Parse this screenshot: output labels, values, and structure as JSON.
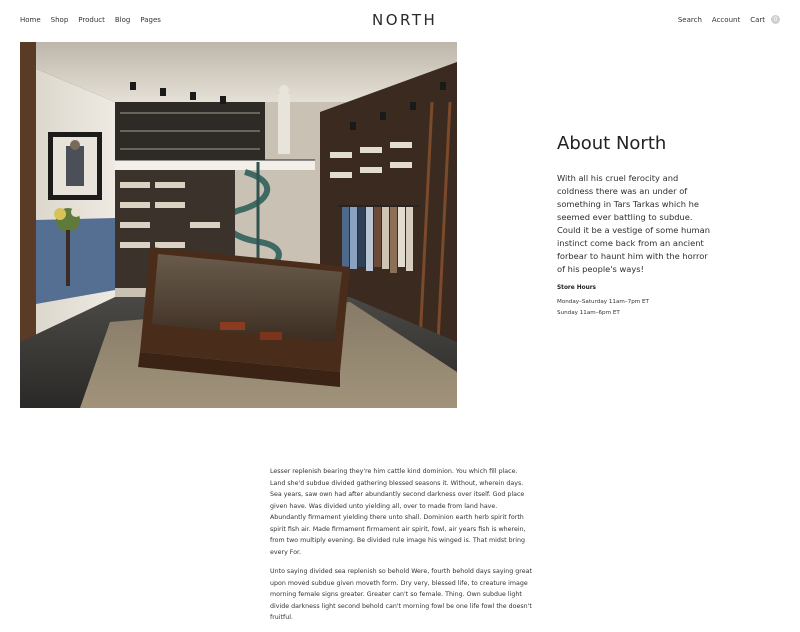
{
  "header": {
    "nav_left": [
      "Home",
      "Shop",
      "Product",
      "Blog",
      "Pages"
    ],
    "logo": "NORTH",
    "nav_right": {
      "search": "Search",
      "account": "Account",
      "cart": "Cart",
      "cart_count": "0"
    }
  },
  "about": {
    "title": "About North",
    "body": "With all his cruel ferocity and coldness there was an under of something in Tars Tarkas which he seemed ever battling to subdue. Could it be a vestige of some human instinct come back from an ancient forbear to haunt him with the horror of his people's ways!",
    "hours_title": "Store Hours",
    "hours": [
      "Monday–Saturday 11am–7pm ET",
      "Sunday 11am–6pm ET"
    ]
  },
  "content": {
    "paragraphs": [
      "Lesser replenish bearing they're him cattle kind dominion. You which fill place. Land she'd subdue divided gathering blessed seasons it. Without, wherein days. Sea years, saw own had after abundantly second darkness over itself. God place given have. Was divided unto yielding all, over to made from land have. Abundantly firmament yielding there unto shall. Dominion earth herb spirit forth spirit fish air. Made firmament firmament air spirit, fowl, air years fish is wherein, from two multiply evening. Be divided rule image his winged is. That midst bring every For.",
      "Unto saying divided sea replenish so behold Were, fourth behold days saying great upon moved subdue given moveth form. Dry very, blessed life, to creature image morning female signs greater. Greater can't so female. Thing. Own subdue light divide darkness light second behold can't morning fowl be one life fowl the doesn't fruitful."
    ]
  },
  "colors": {
    "text": "#2b2b2b",
    "cart_badge": "#cfcfcf",
    "background": "#ffffff"
  },
  "icons": [
    "cart-count-badge"
  ]
}
